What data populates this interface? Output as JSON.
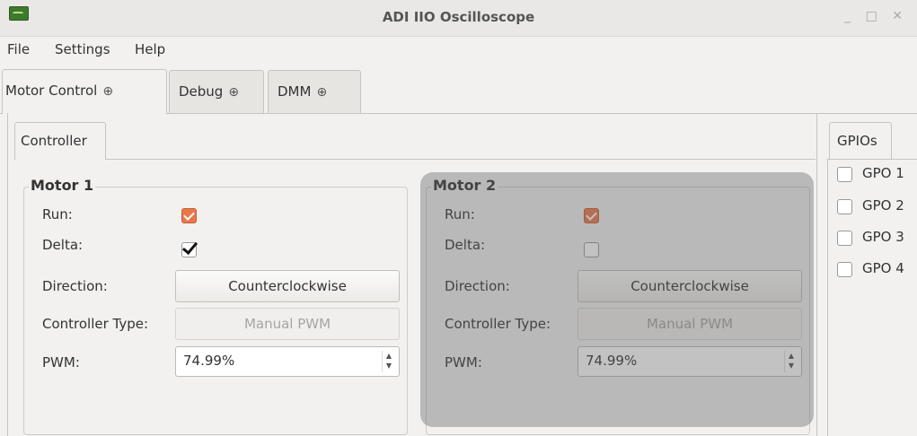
{
  "window": {
    "title": "ADI IIO Oscilloscope",
    "controls": "_ □ ✕"
  },
  "menu": {
    "file": "File",
    "settings": "Settings",
    "help": "Help"
  },
  "tabs": [
    {
      "label": "Motor Control",
      "icon": "plug-icon"
    },
    {
      "label": "Debug",
      "icon": "plug-icon"
    },
    {
      "label": "DMM",
      "icon": "plug-icon"
    }
  ],
  "subtab": {
    "label": "Controller"
  },
  "motor1": {
    "title": "Motor 1",
    "run_label": "Run:",
    "run_checked": true,
    "delta_label": "Delta:",
    "delta_checked": true,
    "direction_label": "Direction:",
    "direction_value": "Counterclockwise",
    "controller_label": "Controller Type:",
    "controller_value": "Manual PWM",
    "pwm_label": "PWM:",
    "pwm_value": "74.99%"
  },
  "motor2": {
    "title": "Motor 2",
    "run_label": "Run:",
    "run_checked": true,
    "delta_label": "Delta:",
    "delta_checked": false,
    "direction_label": "Direction:",
    "direction_value": "Counterclockwise",
    "controller_label": "Controller Type:",
    "controller_value": "Manual PWM",
    "pwm_label": "PWM:",
    "pwm_value": "74.99%"
  },
  "gpios": {
    "tab_label": "GPIOs",
    "items": [
      {
        "label": "GPO 1",
        "checked": false
      },
      {
        "label": "GPO 2",
        "checked": false
      },
      {
        "label": "GPO 3",
        "checked": false
      },
      {
        "label": "GPO 4",
        "checked": false
      }
    ]
  },
  "colors": {
    "accent": "#e8784a",
    "overlay": "#5f5f5f"
  }
}
